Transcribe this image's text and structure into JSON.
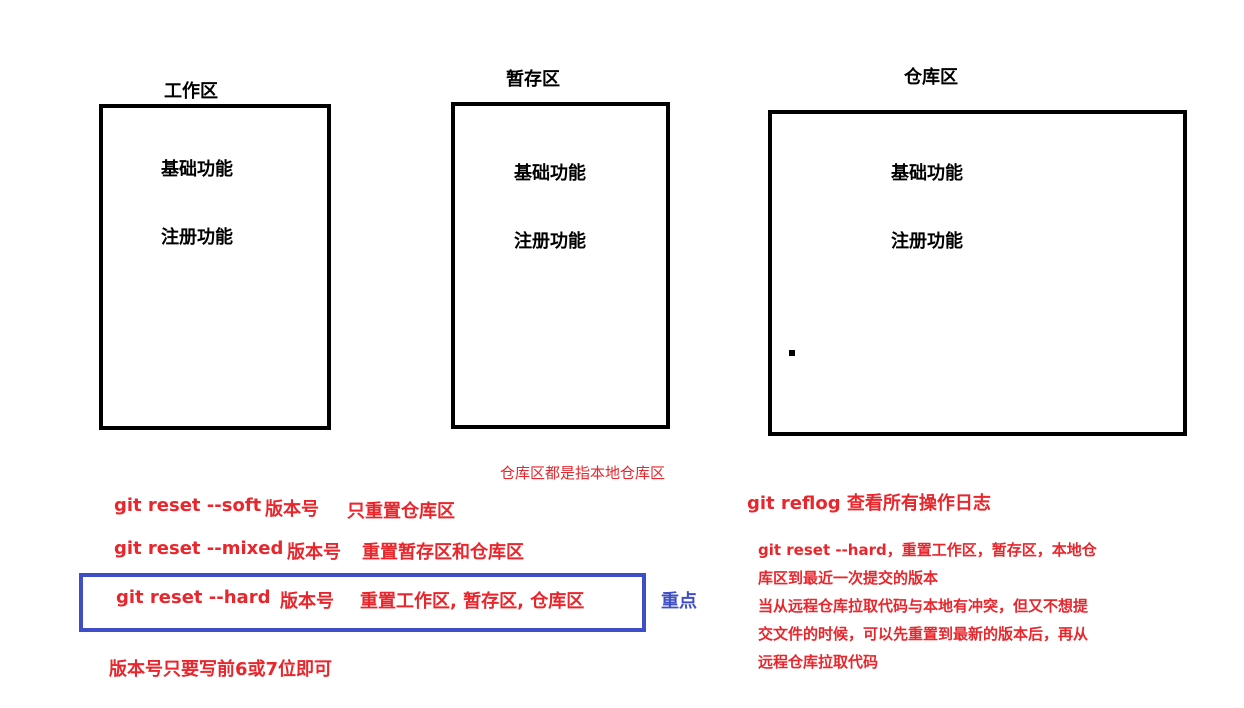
{
  "areas": [
    {
      "title": "工作区",
      "items": [
        "基础功能",
        "注册功能"
      ]
    },
    {
      "title": "暂存区",
      "items": [
        "基础功能",
        "注册功能"
      ]
    },
    {
      "title": "仓库区",
      "items": [
        "基础功能",
        "注册功能"
      ]
    }
  ],
  "repo_note": "仓库区都是指本地仓库区",
  "commands": [
    {
      "cmd": "git reset --soft",
      "arg": "版本号",
      "desc": "只重置仓库区"
    },
    {
      "cmd": "git reset --mixed",
      "arg": "版本号",
      "desc": "重置暂存区和仓库区"
    },
    {
      "cmd": "git reset  --hard",
      "arg": "版本号",
      "desc": "重置工作区, 暂存区, 仓库区"
    }
  ],
  "key_label": "重点",
  "version_note": "版本号只要写前6或7位即可",
  "reflog": "git reflog 查看所有操作日志",
  "hard_note_lines": [
    "git reset --hard，重置工作区，暂存区，本地仓",
    "库区到最近一次提交的版本",
    "当从远程仓库拉取代码与本地有冲突，但又不想提",
    "交文件的时候，可以先重置到最新的版本后，再从",
    "远程仓库拉取代码"
  ],
  "colors": {
    "red": "#e8262c",
    "blue": "#3f4ec6",
    "black": "#000000"
  }
}
